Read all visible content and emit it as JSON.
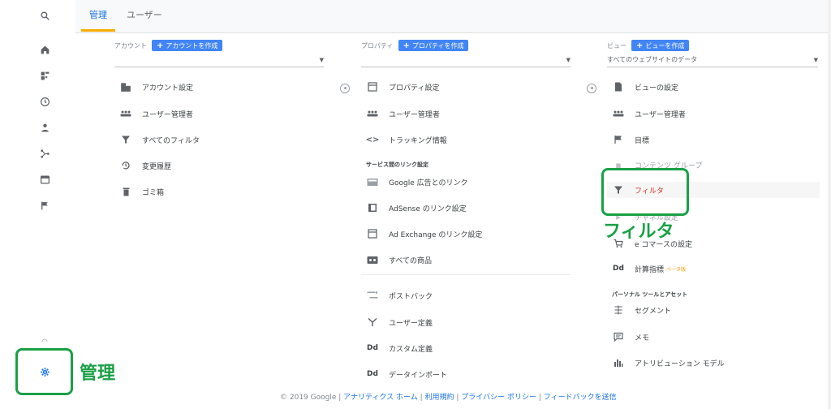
{
  "topbar": {
    "tabs": [
      {
        "label": "管理",
        "active": true
      },
      {
        "label": "ユーザー",
        "active": false
      }
    ]
  },
  "rail": {
    "icons": [
      "search-icon",
      "home-icon",
      "customization-icon",
      "clock-icon",
      "person-icon",
      "acquisition-icon",
      "behavior-icon",
      "flag-icon",
      "lightbulb-icon",
      "settings-icon"
    ]
  },
  "account": {
    "crumb": "アカウント",
    "create_label": "アカウントを作成",
    "selector_value": "",
    "items": [
      {
        "label": "アカウント設定",
        "icon": "building-icon"
      },
      {
        "label": "ユーザー管理者",
        "icon": "users-icon"
      },
      {
        "label": "すべてのフィルタ",
        "icon": "filter-icon"
      },
      {
        "label": "変更履歴",
        "icon": "history-icon"
      },
      {
        "label": "ゴミ箱",
        "icon": "trash-icon"
      }
    ]
  },
  "property": {
    "crumb": "プロパティ",
    "create_label": "プロパティを作成",
    "selector_value": "",
    "items": [
      {
        "label": "プロパティ設定",
        "icon": "window-icon"
      },
      {
        "label": "ユーザー管理者",
        "icon": "users-icon"
      },
      {
        "label": "トラッキング情報",
        "icon": "code-icon"
      }
    ],
    "section_title": "サービス間のリンク設定",
    "link_items": [
      {
        "label": "Google 広告とのリンク",
        "icon": "ads-icon"
      },
      {
        "label": "AdSense のリンク設定",
        "icon": "adsense-icon"
      },
      {
        "label": "Ad Exchange のリンク設定",
        "icon": "adx-icon"
      },
      {
        "label": "すべての商品",
        "icon": "products-icon"
      },
      {
        "label": "ポストバック",
        "icon": "postback-icon"
      },
      {
        "label": "ユーザー定義",
        "icon": "userdefine-icon"
      },
      {
        "label": "カスタム定義",
        "icon": "dd-icon"
      },
      {
        "label": "データインポート",
        "icon": "dd-icon"
      }
    ]
  },
  "view": {
    "crumb": "ビュー",
    "create_label": "ビューを作成",
    "selector_value": "すべてのウェブサイトのデータ",
    "items": [
      {
        "label": "ビューの設定",
        "icon": "doc-icon"
      },
      {
        "label": "ユーザー管理者",
        "icon": "users-icon"
      },
      {
        "label": "目標",
        "icon": "flag-icon"
      },
      {
        "label": "コンテンツ グループ",
        "icon": "content-group-icon"
      },
      {
        "label": "フィルタ",
        "icon": "filter-icon"
      },
      {
        "label": "チャネル設定",
        "icon": "channel-icon"
      },
      {
        "label": "e コマースの設定",
        "icon": "cart-icon"
      },
      {
        "label": "計算指標",
        "icon": "dd-icon",
        "badge": "ベータ版"
      }
    ],
    "section_title": "パーソナル ツールとアセット",
    "tools": [
      {
        "label": "セグメント",
        "icon": "segment-icon"
      },
      {
        "label": "メモ",
        "icon": "memo-icon"
      },
      {
        "label": "アトリビューション モデル",
        "icon": "bar-chart-icon"
      }
    ]
  },
  "annotations": {
    "filter_label": "フィルタ",
    "admin_label": "管理",
    "highlight_color": "#1aa046"
  },
  "footer": {
    "copyright": "© 2019 Google |",
    "links": [
      "アナリティクス ホーム",
      "利用規約",
      "プライバシー ポリシー",
      "フィードバックを送信"
    ]
  },
  "colors": {
    "accent": "#1a73e8",
    "button": "#4285f4",
    "tab_underline": "#f9ab00",
    "filter_active": "#d93025"
  }
}
